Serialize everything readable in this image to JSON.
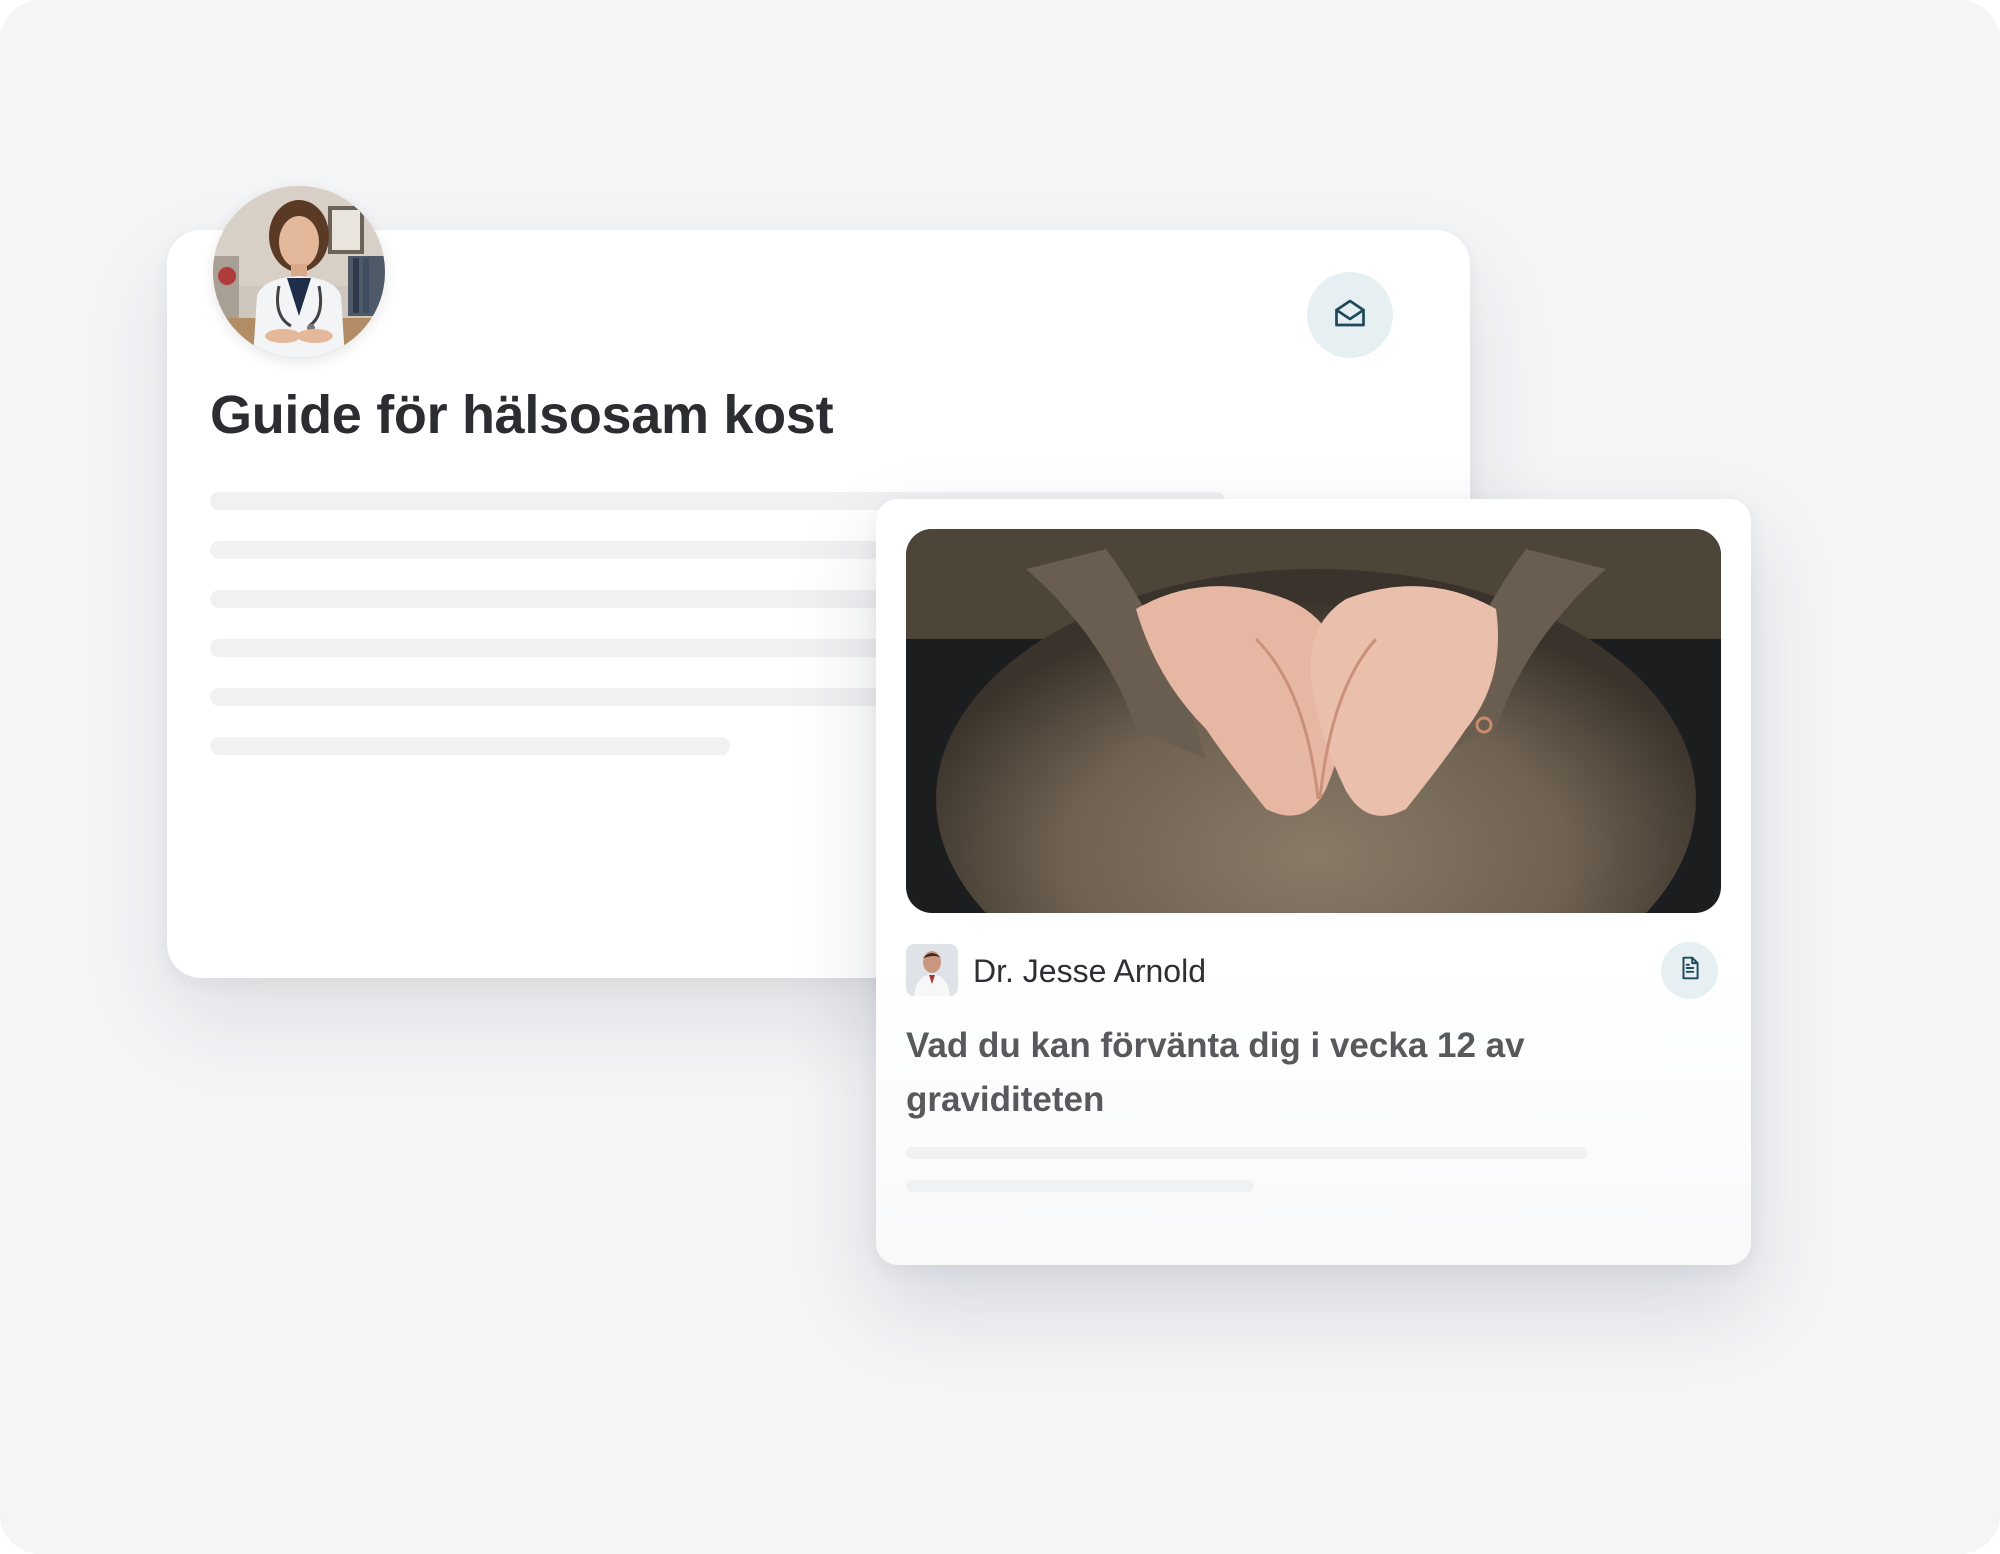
{
  "guide_card": {
    "title": "Guide för hälsosam kost",
    "avatar_icon": "doctor-portrait",
    "action_icon": "open-envelope-icon"
  },
  "article_card": {
    "image_icon": "pregnancy-heart-hands-photo",
    "author_name": "Dr. Jesse Arnold",
    "author_icon": "author-photo",
    "action_icon": "document-icon",
    "title": "Vad du kan förvänta dig i vecka 12 av graviditeten"
  },
  "colors": {
    "background": "#f4f5f7",
    "card": "#ffffff",
    "icon_button_bg": "#e6eff2",
    "icon_stroke": "#1f4a5c",
    "title_text": "#2b2d31",
    "skeleton": "#f0f1f3"
  }
}
